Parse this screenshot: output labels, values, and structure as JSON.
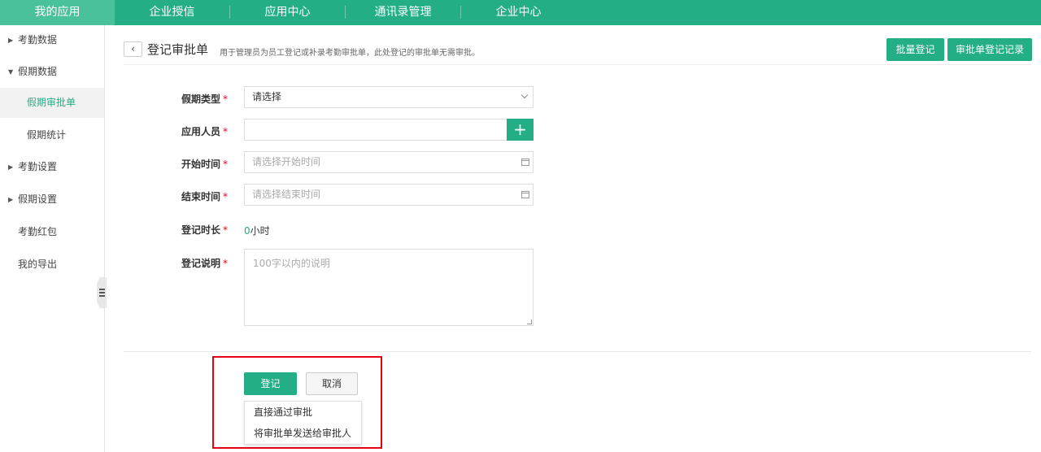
{
  "topnav": {
    "items": [
      "我的应用",
      "企业授信",
      "应用中心",
      "通讯录管理",
      "企业中心"
    ],
    "active_index": 0
  },
  "sidebar": {
    "items": [
      {
        "label": "考勤数据",
        "arrow": "▶"
      },
      {
        "label": "假期数据",
        "arrow": "▼"
      },
      {
        "label": "假期审批单"
      },
      {
        "label": "假期统计"
      },
      {
        "label": "考勤设置",
        "arrow": "▶"
      },
      {
        "label": "假期设置",
        "arrow": "▶"
      },
      {
        "label": "考勤红包"
      },
      {
        "label": "我的导出"
      }
    ],
    "active_item": "假期审批单"
  },
  "header": {
    "back_icon": "‹",
    "title": "登记审批单",
    "description": "用于管理员为员工登记或补录考勤审批单，此处登记的审批单无需审批。",
    "batch_button": "批量登记",
    "records_button": "审批单登记记录"
  },
  "form": {
    "required_mark": "*",
    "leave_type": {
      "label": "假期类型",
      "value": "请选择"
    },
    "person": {
      "label": "应用人员",
      "value": "",
      "add_icon": "+"
    },
    "start_time": {
      "label": "开始时间",
      "placeholder": "请选择开始时间"
    },
    "end_time": {
      "label": "结束时间",
      "placeholder": "请选择结束时间"
    },
    "duration": {
      "label": "登记时长",
      "value": "0",
      "unit": "小时"
    },
    "note": {
      "label": "登记说明",
      "placeholder": "100字以内的说明"
    }
  },
  "actions": {
    "submit": "登记",
    "cancel": "取消",
    "dropdown_options": [
      "直接通过审批",
      "将审批单发送给审批人"
    ]
  },
  "colors": {
    "accent": "#23ae86",
    "highlight_border": "#e60012",
    "required": "#e60012"
  }
}
